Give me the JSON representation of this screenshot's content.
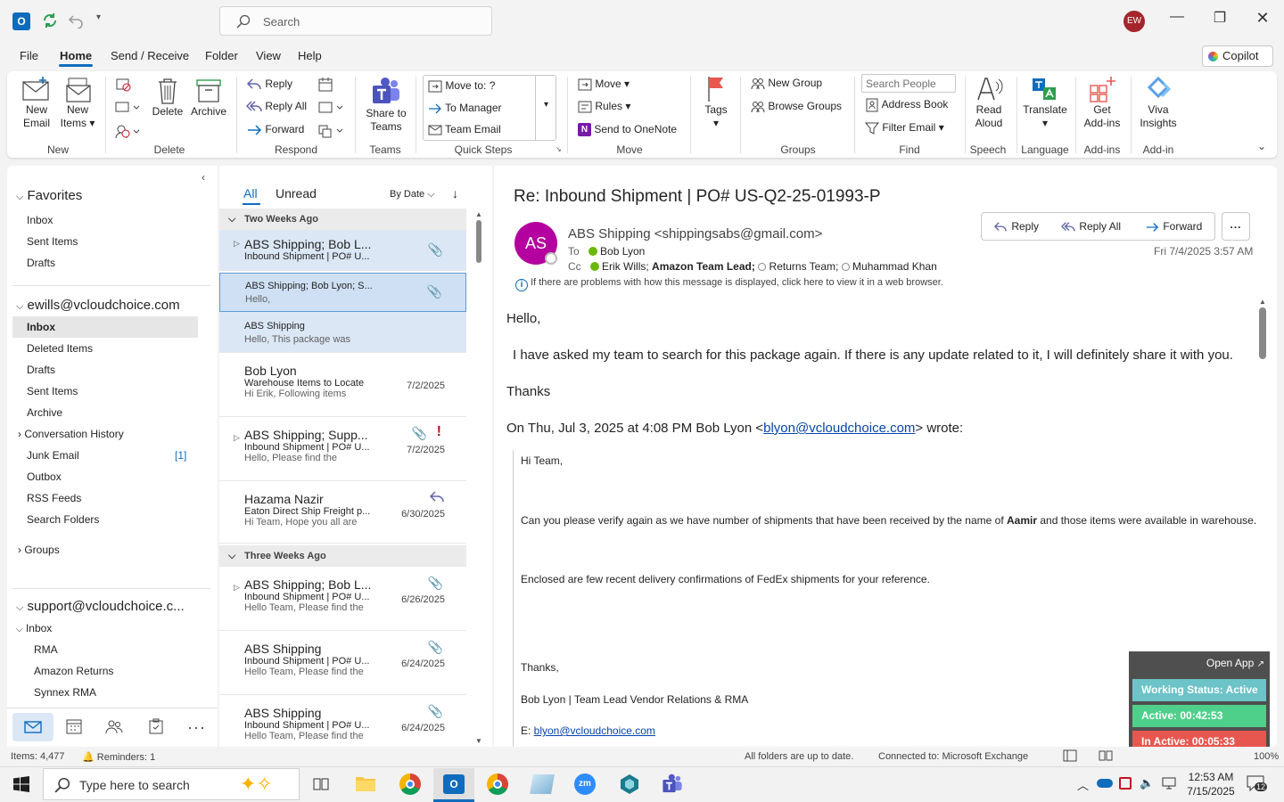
{
  "title_bar": {
    "search_placeholder": "Search",
    "user_initials": "EW"
  },
  "menu": {
    "tabs": [
      "File",
      "Home",
      "Send / Receive",
      "Folder",
      "View",
      "Help"
    ],
    "copilot": "Copilot"
  },
  "ribbon": {
    "new_email": [
      "New",
      "Email"
    ],
    "new_items": [
      "New",
      "Items"
    ],
    "group_new": "New",
    "delete": "Delete",
    "archive": "Archive",
    "group_delete": "Delete",
    "reply": "Reply",
    "reply_all": "Reply All",
    "forward": "Forward",
    "group_respond": "Respond",
    "share_teams": [
      "Share to",
      "Teams"
    ],
    "group_teams": "Teams",
    "qs_move": "Move to: ?",
    "qs_manager": "To Manager",
    "qs_team": "Team Email",
    "group_quicksteps": "Quick Steps",
    "move": "Move",
    "rules": "Rules",
    "onenote": "Send to OneNote",
    "group_move": "Move",
    "tags": "Tags",
    "new_group": "New Group",
    "browse_groups": "Browse Groups",
    "group_groups": "Groups",
    "search_people": "Search People",
    "address_book": "Address Book",
    "filter_email": "Filter Email",
    "group_find": "Find",
    "read_aloud": [
      "Read",
      "Aloud"
    ],
    "group_speech": "Speech",
    "translate": "Translate",
    "group_language": "Language",
    "get_addins": [
      "Get",
      "Add-ins"
    ],
    "group_addins": "Add-ins",
    "viva": [
      "Viva",
      "Insights"
    ],
    "group_addin": "Add-in"
  },
  "nav": {
    "favorites": "Favorites",
    "fav_items": [
      "Inbox",
      "Sent Items",
      "Drafts"
    ],
    "account1": "ewills@vcloudchoice.com",
    "acc1_items": [
      "Inbox",
      "Deleted Items",
      "Drafts",
      "Sent Items",
      "Archive",
      "Conversation History",
      "Junk Email",
      "Outbox",
      "RSS Feeds",
      "Search Folders"
    ],
    "junk_count": "[1]",
    "groups": "Groups",
    "account2": "support@vcloudchoice.c...",
    "acc2_inbox": "Inbox",
    "acc2_items": [
      "RMA",
      "Amazon Returns",
      "Synnex RMA"
    ]
  },
  "list": {
    "tab_all": "All",
    "tab_unread": "Unread",
    "sort": "By Date",
    "group1": "Two Weeks Ago",
    "group2": "Three Weeks Ago",
    "mails": [
      {
        "from": "ABS Shipping;  Bob L...",
        "subj": "Inbound Shipment | PO# U...",
        "prev": "",
        "date": ""
      },
      {
        "from": "ABS Shipping;  Bob Lyon;  S...",
        "subj": "Hello,",
        "prev": "",
        "date": ""
      },
      {
        "from": "ABS Shipping",
        "subj": "Hello,  This package was",
        "prev": "",
        "date": ""
      },
      {
        "from": "Bob Lyon",
        "subj": "Warehouse Items to Locate",
        "prev": "Hi Erik,  Following items",
        "date": "7/2/2025"
      },
      {
        "from": "ABS Shipping;  Supp...",
        "subj": "Inbound Shipment | PO# U...",
        "prev": "Hello,  Please find the",
        "date": "7/2/2025"
      },
      {
        "from": "Hazama Nazir",
        "subj": "Eaton Direct Ship Freight p...",
        "prev": "Hi Team,  Hope you all are",
        "date": "6/30/2025"
      },
      {
        "from": "ABS Shipping;  Bob L...",
        "subj": "Inbound Shipment | PO# U...",
        "prev": "Hello Team,  Please find the",
        "date": "6/26/2025"
      },
      {
        "from": "ABS Shipping",
        "subj": "Inbound Shipment | PO# U...",
        "prev": "Hello Team,  Please find the",
        "date": "6/24/2025"
      },
      {
        "from": "ABS Shipping",
        "subj": "Inbound Shipment | PO# U...",
        "prev": "Hello Team,  Please find the",
        "date": "6/24/2025"
      }
    ]
  },
  "reading": {
    "subject": "Re: Inbound Shipment | PO# US-Q2-25-01993-P",
    "sender_initials": "AS",
    "sender": "ABS Shipping <shippingsabs@gmail.com>",
    "to_label": "To",
    "to": "Bob Lyon",
    "cc_label": "Cc",
    "cc1": "Erik Wills;",
    "cc2": "Amazon Team Lead;",
    "cc3": "Returns Team;",
    "cc4": "Muhammad Khan",
    "reply": "Reply",
    "reply_all": "Reply All",
    "forward": "Forward",
    "more": "...",
    "date": "Fri 7/4/2025 3:57 AM",
    "info": "If there are problems with how this message is displayed, click here to view it in a web browser.",
    "greeting": "Hello,",
    "para1": "I have asked my team to search for this package again. If there is any update related to it, I will definitely share it with you.",
    "thanks": "Thanks",
    "quote_pre": "On Thu, Jul 3, 2025 at 4:08 PM Bob Lyon <",
    "quote_link": "blyon@vcloudchoice.com",
    "quote_post": "> wrote:",
    "q_hi": "Hi Team,",
    "q_p1_a": "Can you please verify again as we have number of shipments that have been received by the name of ",
    "q_p1_b": "Aamir",
    "q_p1_c": " and those items were available in warehouse.",
    "q_p2": "Enclosed are few recent delivery confirmations of FedEx shipments for your reference.",
    "q_thanks": "Thanks,",
    "q_sig": "Bob Lyon | Team Lead Vendor Relations & RMA",
    "q_email_label": "E: ",
    "q_email": "blyon@vcloudchoice.com"
  },
  "widget": {
    "open_app": "Open App",
    "status": "Working Status: Active",
    "active": "Active: 00:42:53",
    "inactive": "In Active: 00:05:33"
  },
  "status_bar": {
    "items": "Items: 4,477",
    "reminders": "Reminders: 1",
    "sync": "All folders are up to date.",
    "connection": "Connected to: Microsoft Exchange",
    "zoom": "100%"
  },
  "taskbar": {
    "search": "Type here to search",
    "time": "12:53 AM",
    "date": "7/15/2025",
    "notif": "12"
  },
  "colors": {
    "accent": "#0f6cbd",
    "avatar": "#b4009e",
    "active_green": "#4fd08a",
    "inactive_red": "#e8574f",
    "status_teal": "#6cc3c8"
  }
}
